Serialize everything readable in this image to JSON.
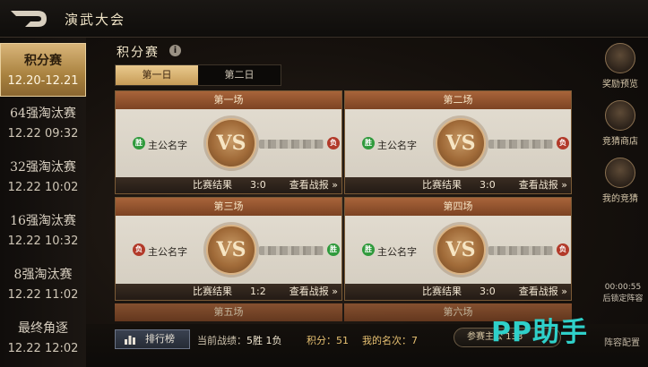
{
  "header": {
    "title": "演武大会"
  },
  "sidebar": {
    "items": [
      {
        "name": "积分赛",
        "date": "12.20-12.21",
        "active": true
      },
      {
        "name": "64强淘汰赛",
        "date": "12.22 09:32",
        "active": false
      },
      {
        "name": "32强淘汰赛",
        "date": "12.22 10:02",
        "active": false
      },
      {
        "name": "16强淘汰赛",
        "date": "12.22 10:32",
        "active": false
      },
      {
        "name": "8强淘汰赛",
        "date": "12.22 11:02",
        "active": false
      },
      {
        "name": "最终角逐",
        "date": "12.22 12:02",
        "active": false
      }
    ]
  },
  "main": {
    "section_title": "积分赛",
    "info_icon_glyph": "i",
    "tabs": [
      {
        "label": "第一日",
        "active": true
      },
      {
        "label": "第二日",
        "active": false
      }
    ],
    "vs_text": "VS",
    "result_label": "比赛结果",
    "report_label": "查看战报 »",
    "matches": [
      {
        "title": "第一场",
        "left_badge": "胜",
        "left_name": "主公名字",
        "right_badge": "负",
        "score": "3:0"
      },
      {
        "title": "第二场",
        "left_badge": "胜",
        "left_name": "主公名字",
        "right_badge": "负",
        "score": "3:0"
      },
      {
        "title": "第三场",
        "left_badge": "负",
        "left_name": "主公名字",
        "right_badge": "胜",
        "score": "1:2"
      },
      {
        "title": "第四场",
        "left_badge": "胜",
        "left_name": "主公名字",
        "right_badge": "负",
        "score": "3:0"
      }
    ],
    "more_matches": [
      "第五场",
      "第六场"
    ]
  },
  "bottom": {
    "rank_button": "排行榜",
    "record_label": "当前战绩：",
    "record_value": "5胜 1负",
    "score_label": "积分：",
    "score_value": "51",
    "rank_label": "我的名次：",
    "rank_value": "7",
    "player_strip": "参赛主公  138"
  },
  "right_rail": {
    "items": [
      {
        "label": "奖励预览",
        "icon": "treasure-chest-icon"
      },
      {
        "label": "竞猜商店",
        "icon": "shop-icon"
      },
      {
        "label": "我的竞猜",
        "icon": "bet-icon"
      }
    ],
    "countdown": "00:00:55",
    "countdown_note": "后锁定阵容",
    "lineup_label": "阵容配置"
  },
  "watermark": "PP助手",
  "colors": {
    "accent_gold": "#d9b57a",
    "win_green": "#2f9a3c",
    "lose_red": "#b23a2a",
    "card_header": "#8e5030"
  }
}
